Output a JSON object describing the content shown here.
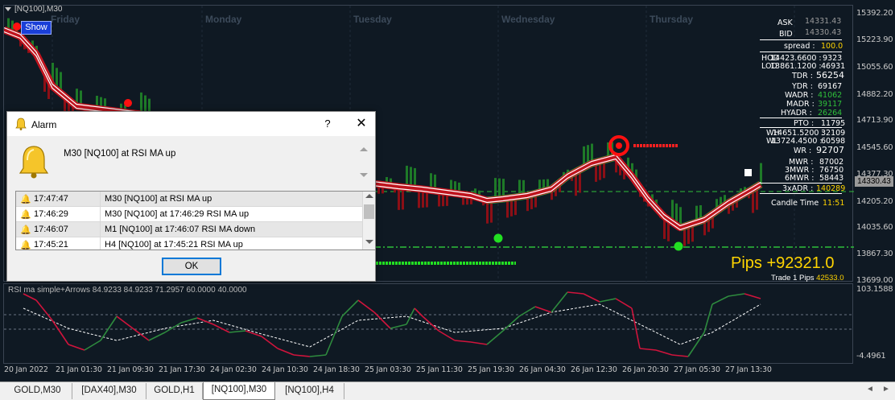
{
  "chart": {
    "symbol_title": "[NQ100],M30",
    "show_button": "Show",
    "day_labels": [
      "Friday",
      "Monday",
      "Tuesday",
      "Wednesday",
      "Thursday"
    ],
    "price_ticks": [
      "15392.20",
      "15223.90",
      "15055.60",
      "14882.20",
      "14713.90",
      "14545.60",
      "14377.30",
      "14205.20",
      "14035.60",
      "13867.30",
      "13699.00"
    ],
    "current_price_label": "14330.43",
    "osc_ticks": [
      "103.1588",
      "-4.4961"
    ],
    "time_ticks": [
      "20 Jan 2022",
      "21 Jan 01:30",
      "21 Jan 09:30",
      "21 Jan 17:30",
      "24 Jan 02:30",
      "24 Jan 10:30",
      "24 Jan 18:30",
      "25 Jan 03:30",
      "25 Jan 11:30",
      "25 Jan 19:30",
      "26 Jan 04:30",
      "26 Jan 12:30",
      "26 Jan 20:30",
      "27 Jan 05:30",
      "27 Jan 13:30"
    ],
    "oscillator_title": "RSI ma simple+Arrows 84.9233 84.9233 71.2957 60.0000 40.0000",
    "colors": {
      "bg": "#0f1923",
      "up": "#2fbf3a",
      "down": "#c0141e",
      "yellow": "#ffd400"
    }
  },
  "info_panel": {
    "ask": {
      "label": "ASK",
      "value": "14331.43"
    },
    "bid": {
      "label": "BID",
      "value": "14330.43"
    },
    "spread": {
      "label": "spread :",
      "value": "100.0"
    },
    "hod": {
      "label": "HOD",
      "mid": "14423.6600 :",
      "value": "9323"
    },
    "lod": {
      "label": "LOD",
      "mid": "13861.1200 :",
      "value": "46931"
    },
    "tdr": {
      "label": "TDR :",
      "value": "56254"
    },
    "ydr": {
      "label": "YDR :",
      "value": "69167"
    },
    "wadr": {
      "label": "WADR :",
      "value": "41062"
    },
    "madr": {
      "label": "MADR :",
      "value": "39117"
    },
    "hyadr": {
      "label": "HYADR :",
      "value": "26264"
    },
    "pto": {
      "label": "PTO :",
      "value": "11795"
    },
    "wh": {
      "label": "WH",
      "mid": "14651.5200 :",
      "value": "32109"
    },
    "wl": {
      "label": "WL",
      "mid": "13724.4500 :",
      "value": "60598"
    },
    "wr": {
      "label": "WR :",
      "value": "92707"
    },
    "mwr": {
      "label": "MWR :",
      "value": "87002"
    },
    "mwr3": {
      "label": "3MWR :",
      "value": "76750"
    },
    "mwr6": {
      "label": "6MWR :",
      "value": "58443"
    },
    "adr3x": {
      "label": "3xADR :",
      "value": "140289"
    },
    "candle_time": {
      "label": "Candle Time",
      "value": "11:51"
    }
  },
  "pips": {
    "big": "Pips +92321.0",
    "small_label": "Trade 1 Pips",
    "small_value": "42533.0"
  },
  "alarm": {
    "title": "Alarm",
    "help": "?",
    "close": "✕",
    "top_message": "M30 [NQ100] at  RSI MA  up",
    "rows": [
      {
        "time": "17:47:47",
        "message": "M30 [NQ100] at  RSI MA  up"
      },
      {
        "time": "17:46:29",
        "message": "M30 [NQ100] at 17:46:29 RSI MA  up"
      },
      {
        "time": "17:46:07",
        "message": "M1 [NQ100] at 17:46:07 RSI MA  down"
      },
      {
        "time": "17:45:21",
        "message": "H4 [NQ100] at 17:45:21 RSI MA  up"
      }
    ],
    "ok": "OK"
  },
  "tabs": [
    {
      "label": "GOLD,M30"
    },
    {
      "label": "[DAX40],M30"
    },
    {
      "label": "GOLD,H1"
    },
    {
      "label": "[NQ100],M30"
    },
    {
      "label": "[NQ100],H4"
    }
  ],
  "tab_arrows": {
    "left": "◄",
    "right": "►"
  }
}
